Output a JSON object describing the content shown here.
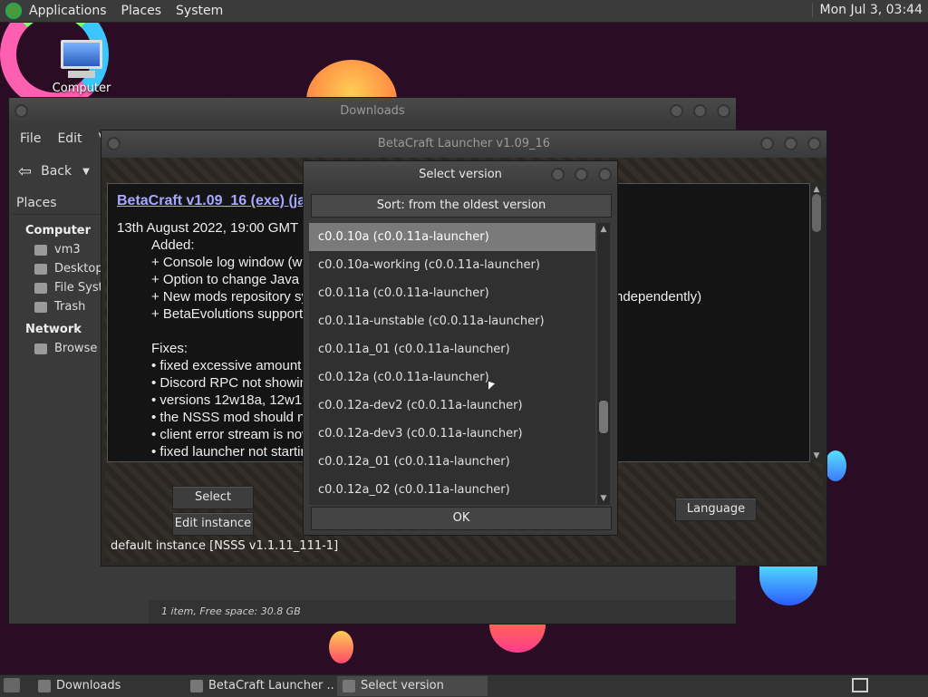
{
  "top_panel": {
    "menus": [
      "Applications",
      "Places",
      "System"
    ],
    "clock": "Mon Jul 3, 03:44"
  },
  "desktop": {
    "computer_label": "Computer"
  },
  "downloads": {
    "title": "Downloads",
    "menus": [
      "File",
      "Edit",
      "V"
    ],
    "back_label": "Back",
    "sidebar": {
      "header": "Places",
      "computer_group": "Computer",
      "computer_items": [
        "vm3",
        "Desktop",
        "File Syste",
        "Trash"
      ],
      "network_group": "Network",
      "network_items": [
        "Browse N"
      ]
    },
    "status": "1 item, Free space: 30.8 GB"
  },
  "betacraft": {
    "title": "BetaCraft Launcher v1.09_16",
    "news": {
      "headline": "BetaCraft v1.09_16 (exe) (jar)",
      "date": "13th August 2022, 19:00 GMT",
      "added_label": "Added:",
      "added": [
        "+ Console log window (wit",
        "+ Option to change Java p",
        "+ New mods repository sy",
        "+ BetaEvolutions support"
      ],
      "added_tail": "ndependently)",
      "fixes_label": "Fixes:",
      "fixes": [
        "• fixed excessive amount",
        "• Discord RPC not showin",
        "• versions 12w18a, 12w19",
        "• the NSSS mod should no",
        "• client error stream is now",
        "• fixed launcher not startin"
      ]
    },
    "buttons": {
      "select_version": "Select version",
      "edit_instance": "Edit instance",
      "language": "Language"
    },
    "instance": "default instance [NSSS v1.1.11_111-1]"
  },
  "select_version": {
    "title": "Select version",
    "sort_label": "Sort: from the oldest version",
    "versions": [
      "c0.0.10a (c0.0.11a-launcher)",
      "c0.0.10a-working (c0.0.11a-launcher)",
      "c0.0.11a (c0.0.11a-launcher)",
      "c0.0.11a-unstable (c0.0.11a-launcher)",
      "c0.0.11a_01 (c0.0.11a-launcher)",
      "c0.0.12a (c0.0.11a-launcher)",
      "c0.0.12a-dev2 (c0.0.11a-launcher)",
      "c0.0.12a-dev3 (c0.0.11a-launcher)",
      "c0.0.12a_01 (c0.0.11a-launcher)",
      "c0.0.12a_02 (c0.0.11a-launcher)"
    ],
    "selected": "c0.0.10a (c0.0.11a-launcher)",
    "ok_label": "OK"
  },
  "taskbar": {
    "tasks": [
      "Downloads",
      "BetaCraft Launcher ...",
      "Select version"
    ],
    "active": "Select version"
  }
}
